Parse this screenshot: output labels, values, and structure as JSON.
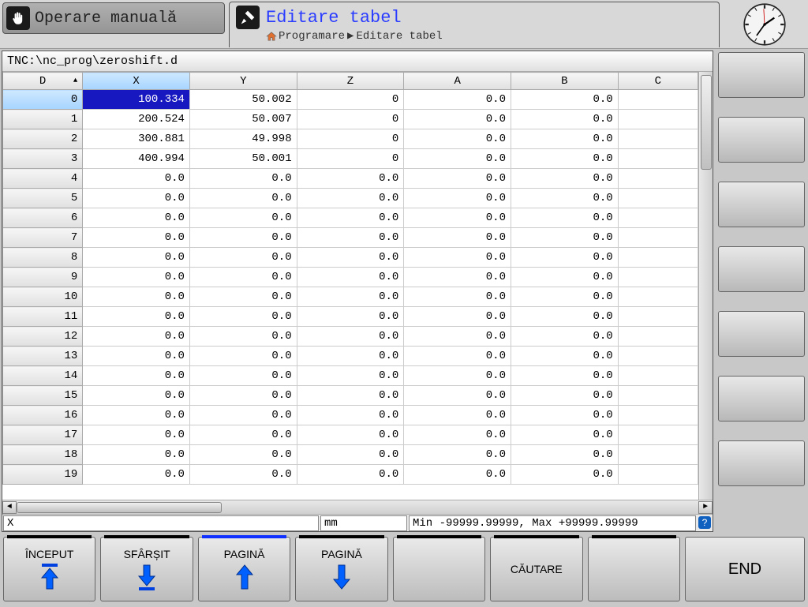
{
  "modes": {
    "inactive_label": "Operare manuală",
    "active_label": "Editare tabel"
  },
  "breadcrumb": {
    "level1": "Programare",
    "level2": "Editare tabel"
  },
  "filepath": "TNC:\\nc_prog\\zeroshift.d",
  "table": {
    "columns": [
      "D",
      "X",
      "Y",
      "Z",
      "A",
      "B",
      "C"
    ],
    "rows": [
      {
        "d": "0",
        "x": "100.334",
        "y": "50.002",
        "z": "0",
        "a": "0.0",
        "b": "0.0",
        "c": ""
      },
      {
        "d": "1",
        "x": "200.524",
        "y": "50.007",
        "z": "0",
        "a": "0.0",
        "b": "0.0",
        "c": ""
      },
      {
        "d": "2",
        "x": "300.881",
        "y": "49.998",
        "z": "0",
        "a": "0.0",
        "b": "0.0",
        "c": ""
      },
      {
        "d": "3",
        "x": "400.994",
        "y": "50.001",
        "z": "0",
        "a": "0.0",
        "b": "0.0",
        "c": ""
      },
      {
        "d": "4",
        "x": "0.0",
        "y": "0.0",
        "z": "0.0",
        "a": "0.0",
        "b": "0.0",
        "c": ""
      },
      {
        "d": "5",
        "x": "0.0",
        "y": "0.0",
        "z": "0.0",
        "a": "0.0",
        "b": "0.0",
        "c": ""
      },
      {
        "d": "6",
        "x": "0.0",
        "y": "0.0",
        "z": "0.0",
        "a": "0.0",
        "b": "0.0",
        "c": ""
      },
      {
        "d": "7",
        "x": "0.0",
        "y": "0.0",
        "z": "0.0",
        "a": "0.0",
        "b": "0.0",
        "c": ""
      },
      {
        "d": "8",
        "x": "0.0",
        "y": "0.0",
        "z": "0.0",
        "a": "0.0",
        "b": "0.0",
        "c": ""
      },
      {
        "d": "9",
        "x": "0.0",
        "y": "0.0",
        "z": "0.0",
        "a": "0.0",
        "b": "0.0",
        "c": ""
      },
      {
        "d": "10",
        "x": "0.0",
        "y": "0.0",
        "z": "0.0",
        "a": "0.0",
        "b": "0.0",
        "c": ""
      },
      {
        "d": "11",
        "x": "0.0",
        "y": "0.0",
        "z": "0.0",
        "a": "0.0",
        "b": "0.0",
        "c": ""
      },
      {
        "d": "12",
        "x": "0.0",
        "y": "0.0",
        "z": "0.0",
        "a": "0.0",
        "b": "0.0",
        "c": ""
      },
      {
        "d": "13",
        "x": "0.0",
        "y": "0.0",
        "z": "0.0",
        "a": "0.0",
        "b": "0.0",
        "c": ""
      },
      {
        "d": "14",
        "x": "0.0",
        "y": "0.0",
        "z": "0.0",
        "a": "0.0",
        "b": "0.0",
        "c": ""
      },
      {
        "d": "15",
        "x": "0.0",
        "y": "0.0",
        "z": "0.0",
        "a": "0.0",
        "b": "0.0",
        "c": ""
      },
      {
        "d": "16",
        "x": "0.0",
        "y": "0.0",
        "z": "0.0",
        "a": "0.0",
        "b": "0.0",
        "c": ""
      },
      {
        "d": "17",
        "x": "0.0",
        "y": "0.0",
        "z": "0.0",
        "a": "0.0",
        "b": "0.0",
        "c": ""
      },
      {
        "d": "18",
        "x": "0.0",
        "y": "0.0",
        "z": "0.0",
        "a": "0.0",
        "b": "0.0",
        "c": ""
      },
      {
        "d": "19",
        "x": "0.0",
        "y": "0.0",
        "z": "0.0",
        "a": "0.0",
        "b": "0.0",
        "c": ""
      }
    ],
    "selected_row": 0,
    "selected_col": "x"
  },
  "status": {
    "field": "X",
    "unit": "mm",
    "range": "Min -99999.99999, Max +99999.99999"
  },
  "softkeys": {
    "sk1": "ÎNCEPUT",
    "sk2": "SFÂRȘIT",
    "sk3": "PAGINĂ",
    "sk4": "PAGINĂ",
    "sk5": "",
    "sk6": "CĂUTARE",
    "sk7": "",
    "end": "END"
  }
}
